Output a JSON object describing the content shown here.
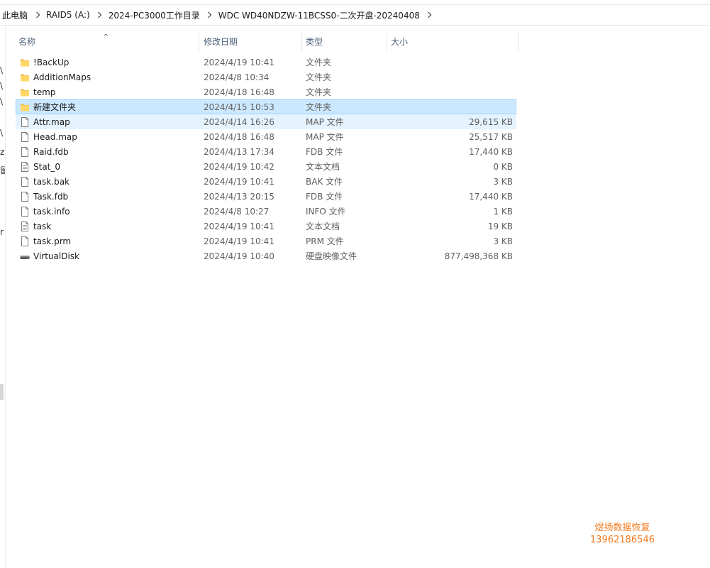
{
  "breadcrumb": [
    "此电脑",
    "RAID5 (A:)",
    "2024-PC3000工作目录",
    "WDC WD40NDZW-11BCSS0-二次开盘-20240408"
  ],
  "left_pane_fragments": [
    "\\",
    "\\",
    "\\",
    "\\",
    "zy",
    "留",
    "r"
  ],
  "columns": {
    "name": "名称",
    "date": "修改日期",
    "type": "类型",
    "size": "大小"
  },
  "files": [
    {
      "name": "!BackUp",
      "date": "2024/4/19 10:41",
      "type": "文件夹",
      "size": "",
      "icon": "folder-icon"
    },
    {
      "name": "AdditionMaps",
      "date": "2024/4/8 10:34",
      "type": "文件夹",
      "size": "",
      "icon": "folder-icon"
    },
    {
      "name": "temp",
      "date": "2024/4/18 16:48",
      "type": "文件夹",
      "size": "",
      "icon": "folder-icon"
    },
    {
      "name": "新建文件夹",
      "date": "2024/4/15 10:53",
      "type": "文件夹",
      "size": "",
      "icon": "folder-icon"
    },
    {
      "name": "Attr.map",
      "date": "2024/4/14 16:26",
      "type": "MAP 文件",
      "size": "29,615 KB",
      "icon": "file-icon"
    },
    {
      "name": "Head.map",
      "date": "2024/4/18 16:48",
      "type": "MAP 文件",
      "size": "25,517 KB",
      "icon": "file-icon"
    },
    {
      "name": "Raid.fdb",
      "date": "2024/4/13 17:34",
      "type": "FDB 文件",
      "size": "17,440 KB",
      "icon": "file-icon"
    },
    {
      "name": "Stat_0",
      "date": "2024/4/19 10:42",
      "type": "文本文档",
      "size": "0 KB",
      "icon": "text-file-icon"
    },
    {
      "name": "task.bak",
      "date": "2024/4/19 10:41",
      "type": "BAK 文件",
      "size": "3 KB",
      "icon": "file-icon"
    },
    {
      "name": "Task.fdb",
      "date": "2024/4/13 20:15",
      "type": "FDB 文件",
      "size": "17,440 KB",
      "icon": "file-icon"
    },
    {
      "name": "task.info",
      "date": "2024/4/8 10:27",
      "type": "INFO 文件",
      "size": "1 KB",
      "icon": "file-icon"
    },
    {
      "name": "task",
      "date": "2024/4/19 10:41",
      "type": "文本文档",
      "size": "19 KB",
      "icon": "text-file-icon"
    },
    {
      "name": "task.prm",
      "date": "2024/4/19 10:41",
      "type": "PRM 文件",
      "size": "3 KB",
      "icon": "file-icon"
    },
    {
      "name": "VirtualDisk",
      "date": "2024/4/19 10:40",
      "type": "硬盘映像文件",
      "size": "877,498,368 KB",
      "icon": "disk-image-icon"
    }
  ],
  "selected_row": 3,
  "hover_row": 4,
  "watermark": {
    "line1": "煜扬数据恢复",
    "line2": "13962186546"
  },
  "colors": {
    "selection": "#cce8ff",
    "selection_border": "#99d1ff",
    "hover": "#e5f3ff",
    "folder": "#ffd766",
    "watermark": "#f07a1e"
  }
}
